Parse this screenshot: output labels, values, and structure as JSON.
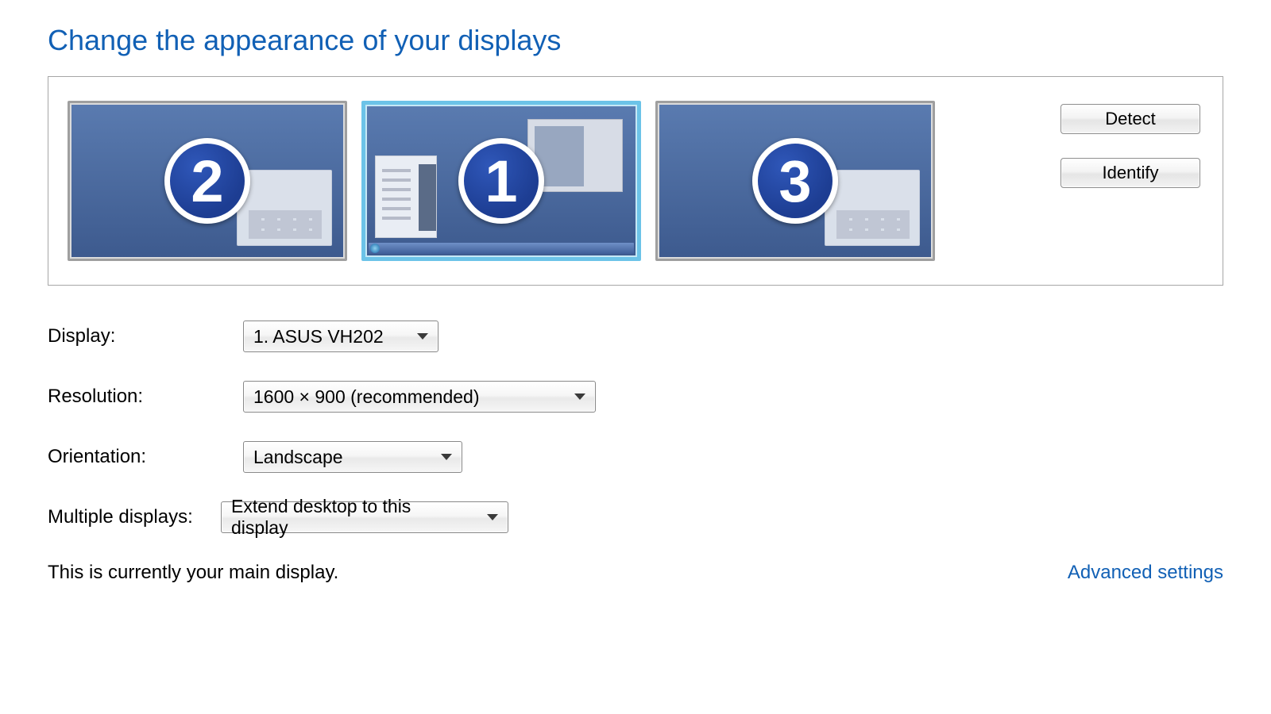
{
  "title": "Change the appearance of your displays",
  "monitors": {
    "left": {
      "number": "2",
      "selected": false
    },
    "center": {
      "number": "1",
      "selected": true
    },
    "right": {
      "number": "3",
      "selected": false
    }
  },
  "buttons": {
    "detect": "Detect",
    "identify": "Identify"
  },
  "form": {
    "display_label": "Display:",
    "display_value": "1. ASUS VH202",
    "resolution_label": "Resolution:",
    "resolution_value": "1600 × 900 (recommended)",
    "orientation_label": "Orientation:",
    "orientation_value": "Landscape",
    "multiple_label": "Multiple displays:",
    "multiple_value": "Extend desktop to this display"
  },
  "status_text": "This is currently your main display.",
  "advanced_link": "Advanced settings"
}
